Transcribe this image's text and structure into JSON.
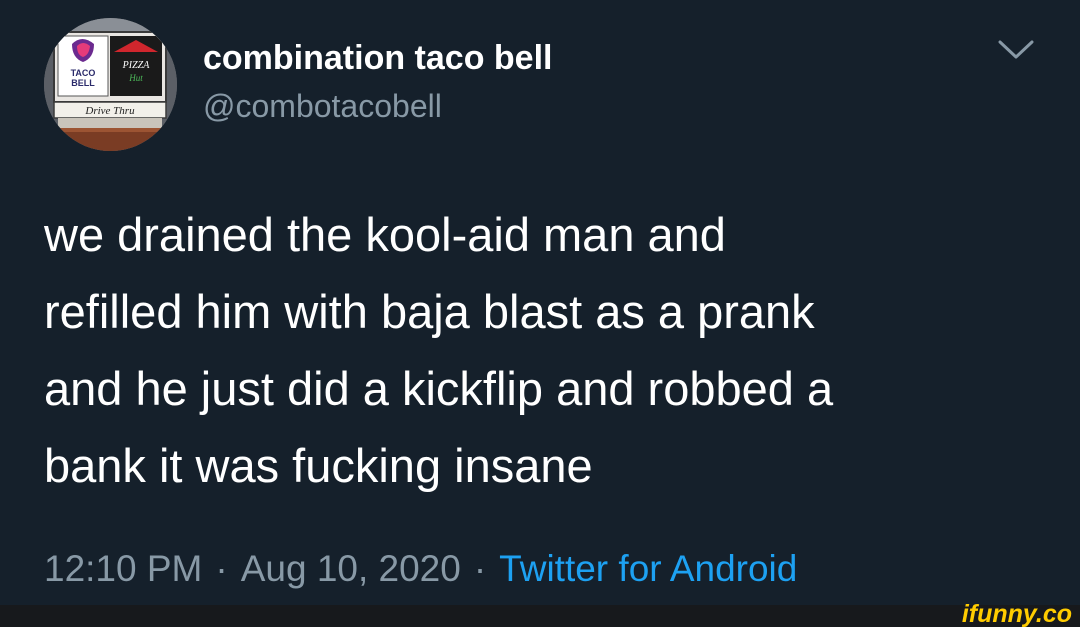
{
  "tweet": {
    "author": {
      "display_name": "combination taco bell",
      "handle": "@combotacobell",
      "avatar_sign_text": [
        "TACO",
        "BELL",
        "PIZZA",
        "Hut",
        "Drive Thru"
      ]
    },
    "menu_icon": "chevron-down-icon",
    "text_lines": [
      "we drained the kool-aid man and",
      "refilled him with baja blast as a prank",
      "and he just did a kickflip and robbed a",
      "bank it was fucking insane"
    ],
    "timestamp": "12:10 PM",
    "separator": "·",
    "date": "Aug 10, 2020",
    "source": "Twitter for Android"
  },
  "watermark": "ifunny.co",
  "colors": {
    "background": "#15202b",
    "text": "#ffffff",
    "secondary_text": "#8899a6",
    "link": "#1da1f2",
    "watermark": "#ffcc00"
  }
}
